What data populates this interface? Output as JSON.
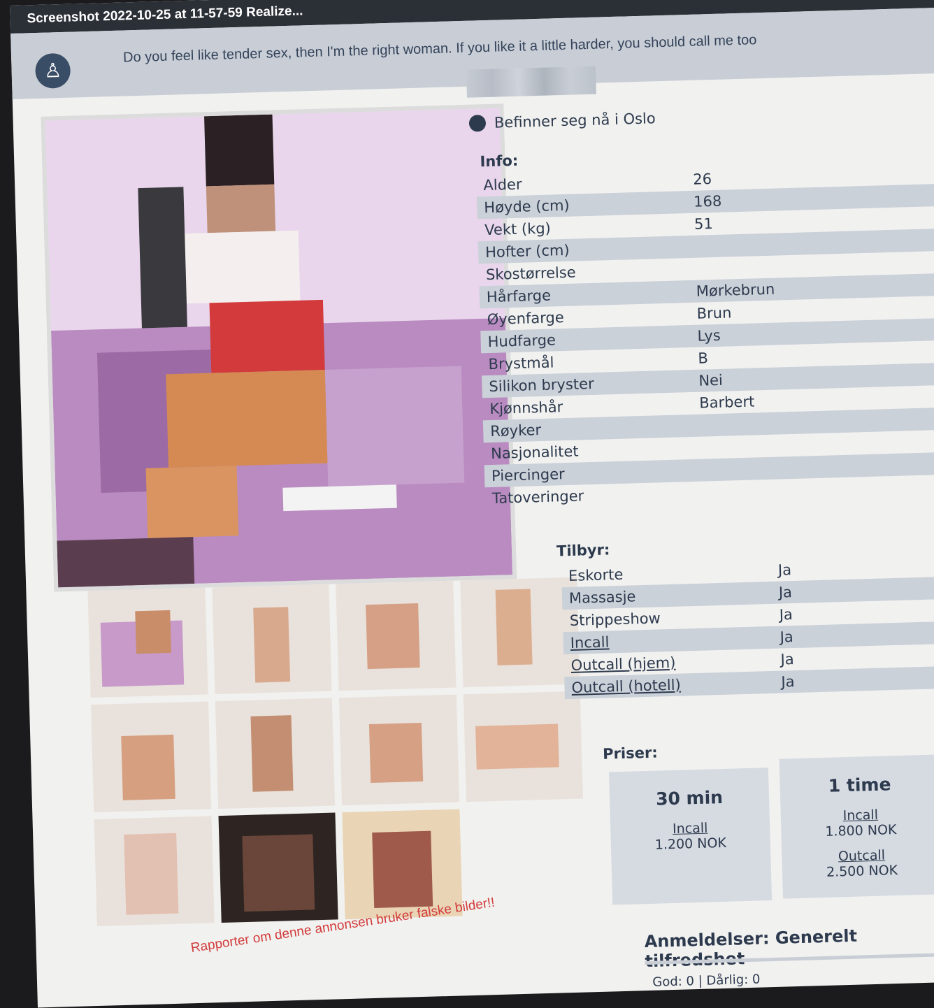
{
  "window": {
    "title": "Screenshot 2022-10-25 at 11-57-59 Realize..."
  },
  "banner": {
    "tagline": "Do you feel like tender sex, then I'm the right woman. If you like it a little harder, you should call me too",
    "badge_icon": "person-badge-icon"
  },
  "profile": {
    "location_text": "Befinner seg nå i Oslo",
    "location_icon": "globe-icon"
  },
  "info": {
    "title": "Info:",
    "rows": [
      {
        "label": "Alder",
        "value": "26"
      },
      {
        "label": "Høyde (cm)",
        "value": "168"
      },
      {
        "label": "Vekt (kg)",
        "value": "51"
      },
      {
        "label": "Hofter (cm)",
        "value": ""
      },
      {
        "label": "Skostørrelse",
        "value": ""
      },
      {
        "label": "Hårfarge",
        "value": "Mørkebrun"
      },
      {
        "label": "Øyenfarge",
        "value": "Brun"
      },
      {
        "label": "Hudfarge",
        "value": "Lys"
      },
      {
        "label": "Brystmål",
        "value": "B"
      },
      {
        "label": "Silikon bryster",
        "value": "Nei"
      },
      {
        "label": "Kjønnshår",
        "value": "Barbert"
      },
      {
        "label": "Røyker",
        "value": ""
      },
      {
        "label": "Nasjonalitet",
        "value": ""
      },
      {
        "label": "Piercinger",
        "value": ""
      },
      {
        "label": "Tatoveringer",
        "value": ""
      }
    ]
  },
  "offers": {
    "title": "Tilbyr:",
    "rows": [
      {
        "label": "Eskorte",
        "value": "Ja"
      },
      {
        "label": "Massasje",
        "value": "Ja"
      },
      {
        "label": "Strippeshow",
        "value": "Ja"
      },
      {
        "label": "Incall",
        "value": "Ja"
      },
      {
        "label": "Outcall (hjem)",
        "value": "Ja"
      },
      {
        "label": "Outcall (hotell)",
        "value": "Ja"
      }
    ]
  },
  "prices": {
    "title": "Priser:",
    "boxes": [
      {
        "heading": "30 min",
        "incall_label": "Incall",
        "incall_price": "1.200 NOK"
      },
      {
        "heading": "1 time",
        "incall_label": "Incall",
        "incall_price": "1.800 NOK",
        "outcall_label": "Outcall",
        "outcall_price": "2.500 NOK"
      }
    ]
  },
  "report_link": "Rapporter om denne annonsen bruker falske bilder!!",
  "reviews": {
    "title": "Anmeldelser: Generelt tilfredshet",
    "stats": "God: 0 | Dårlig: 0"
  },
  "colors": {
    "accent": "#2d3a4e",
    "stripe": "#cbd1d9",
    "report": "#d23b3b"
  }
}
